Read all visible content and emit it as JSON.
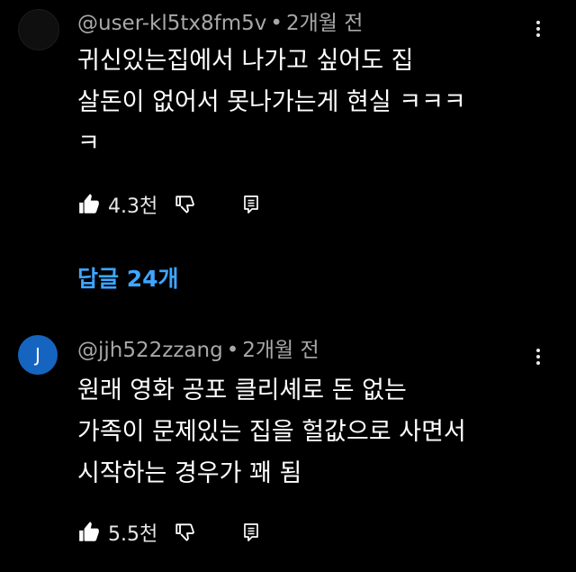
{
  "comments": [
    {
      "avatar_letter": "",
      "avatar_color": "#0f0f0f",
      "username": "@user-kl5tx8fm5v",
      "separator": "•",
      "time": "2개월 전",
      "lines": [
        "귀신있는집에서 나가고 싶어도 집",
        "살돈이 없어서 못나가는게 현실 ㅋㅋㅋ",
        "ㅋ"
      ],
      "likes": "4.3천"
    },
    {
      "avatar_letter": "J",
      "avatar_color": "#1565c0",
      "username": "@jjh522zzang",
      "separator": "•",
      "time": "2개월 전",
      "lines": [
        "원래 영화 공포 클리셰로 돈 없는",
        "가족이 문제있는 집을 헐값으로 사면서",
        "시작하는 경우가 꽤 됨"
      ],
      "likes": "5.5천"
    }
  ],
  "replies_label": "답글 24개",
  "colors": {
    "background": "#000000",
    "accent": "#3ea6ff",
    "meta_text": "#a8a8a8"
  },
  "icons": [
    "thumb-up-icon",
    "thumb-down-icon",
    "reply-icon",
    "more-vert-icon"
  ]
}
